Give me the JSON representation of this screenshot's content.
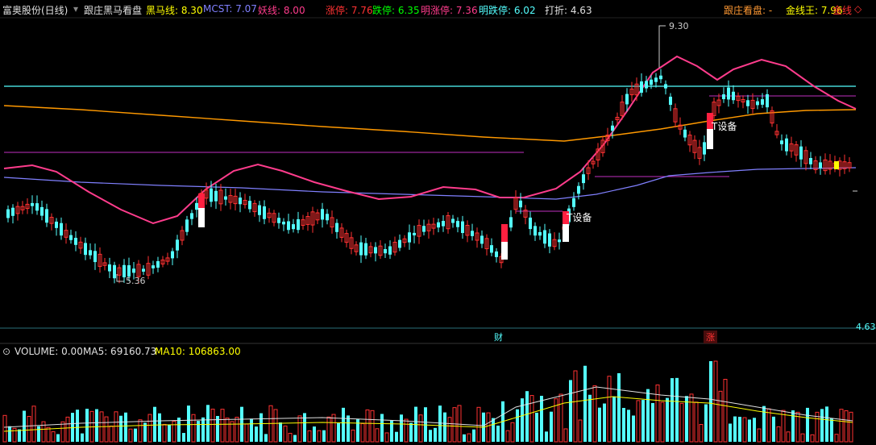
{
  "header": {
    "stock_name": "富奥股份(日线)",
    "indicator_title": "跟庄黑马看盘",
    "heima_label": "黑马线: 8.30",
    "mcst_label": "MCST: 7.07",
    "yao_label": "妖线: 8.00",
    "zhangting_label": "涨停: 7.76",
    "dieting_label": "跌停: 6.35",
    "ming_zhangting_label": "明涨停: 7.36",
    "ming_dieting_label": "明跌停: 6.02",
    "dazhe_label": "打折: 4.63",
    "right_title": "跟庄看盘: -",
    "jinxianwang_label": "金线王: 7.96",
    "jinxian_label": "金线",
    "diamond_icon": "diamond-icon"
  },
  "price_annotations": {
    "high_label": "9.30",
    "low_label": "5.36",
    "right_axis_value": "4.63",
    "device_label_1": "T设备",
    "device_label_2": "T设备",
    "cai_marker": "财",
    "zhang_marker": "涨"
  },
  "volume_header": {
    "volume_label": "VOLUME: 0.00",
    "ma5_label": "MA5: 69160.73",
    "ma10_label": "MA10: 106863.00"
  },
  "colors": {
    "background": "#000000",
    "up": "#ff3232",
    "down": "#54ffff",
    "pink_line": "#ff3c8c",
    "orange_line": "#ff9900",
    "cyan_line": "#54ffff",
    "lavender_line": "#8080ff",
    "magenta_line": "#ff00ff",
    "yellow": "#ffff00",
    "white": "#ffffff"
  }
}
